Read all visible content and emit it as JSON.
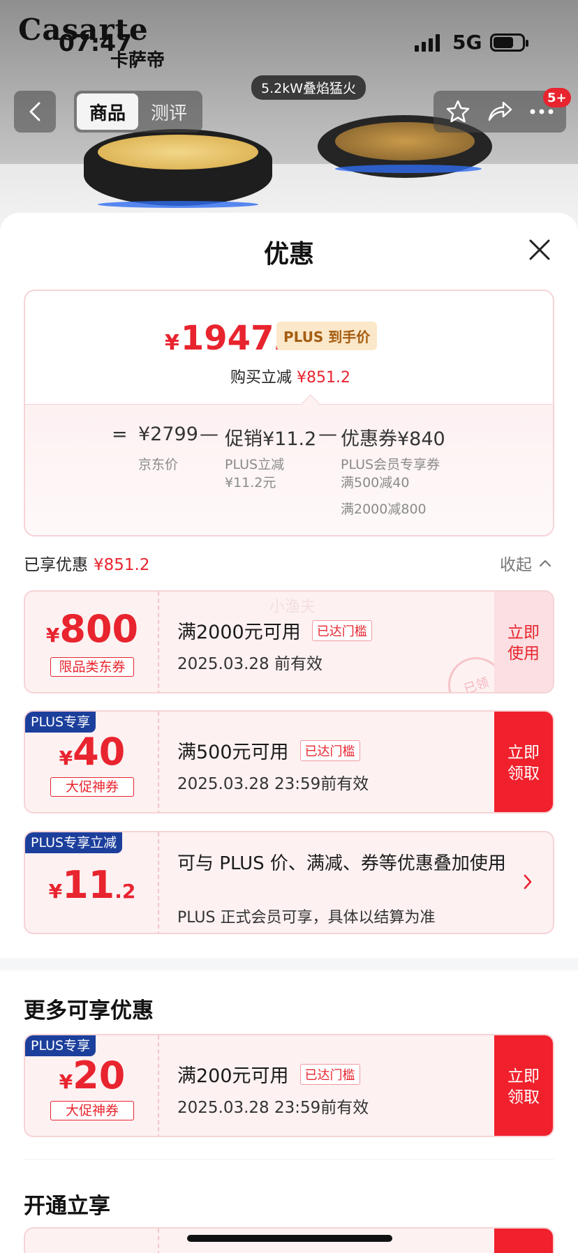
{
  "status": {
    "time": "07:47",
    "network": "5G"
  },
  "hero": {
    "brand": "Casarte",
    "brand_cn": "卡萨帝",
    "spec_tag": "5.2kW叠焰猛火"
  },
  "nav": {
    "tabs": [
      {
        "label": "商品"
      },
      {
        "label": "测评"
      }
    ],
    "badge": "5+"
  },
  "sheet": {
    "title": "优惠",
    "final_price": {
      "currency": "¥",
      "integer": "1947",
      "decimal": ".8",
      "tag": "PLUS 到手价"
    },
    "saving": {
      "label": "购买立减",
      "amount": "¥851.2"
    },
    "formula": {
      "eq": "=",
      "base": "¥2799",
      "base_label": "京东价",
      "minus1": "—",
      "promo": "促销¥11.2",
      "promo_sub1": "PLUS立减",
      "promo_sub2": "¥11.2元",
      "minus2": "—",
      "coupon": "优惠券¥840",
      "coupon_sub1": "PLUS会员专享券",
      "coupon_sub2": "满500减40",
      "coupon_sub3": "满2000减800"
    },
    "enjoyed": {
      "label": "已享优惠",
      "amount": "¥851.2",
      "collapse": "收起"
    }
  },
  "coupons": [
    {
      "currency": "¥",
      "integer": "800",
      "type": "限品类东券",
      "condition": "满2000元可用",
      "reached": "已达门槛",
      "valid": "2025.03.28 前有效",
      "cta_line1": "立即",
      "cta_line2": "使用",
      "stamp": "已领",
      "watermark": "小渔夫"
    },
    {
      "plus": "PLUS专享",
      "currency": "¥",
      "integer": "40",
      "type": "大促神券",
      "condition": "满500元可用",
      "reached": "已达门槛",
      "valid": "2025.03.28 23:59前有效",
      "cta_line1": "立即",
      "cta_line2": "领取"
    },
    {
      "plus": "PLUS专享立减",
      "currency": "¥",
      "integer": "11",
      "decimal": ".2",
      "desc": "可与 PLUS 价、满减、券等优惠叠加使用",
      "desc2": "PLUS 正式会员可享，具体以结算为准"
    }
  ],
  "more": {
    "title": "更多可享优惠",
    "coupon": {
      "plus": "PLUS专享",
      "currency": "¥",
      "integer": "20",
      "type": "大促神券",
      "condition": "满200元可用",
      "reached": "已达门槛",
      "valid": "2025.03.28 23:59前有效",
      "cta_line1": "立即",
      "cta_line2": "领取"
    }
  },
  "open": {
    "title": "开通立享"
  },
  "colors": {
    "accent_red": "#e8242e",
    "plus_blue": "#1c3f9c",
    "coupon_bg": "#fdf1f2"
  }
}
